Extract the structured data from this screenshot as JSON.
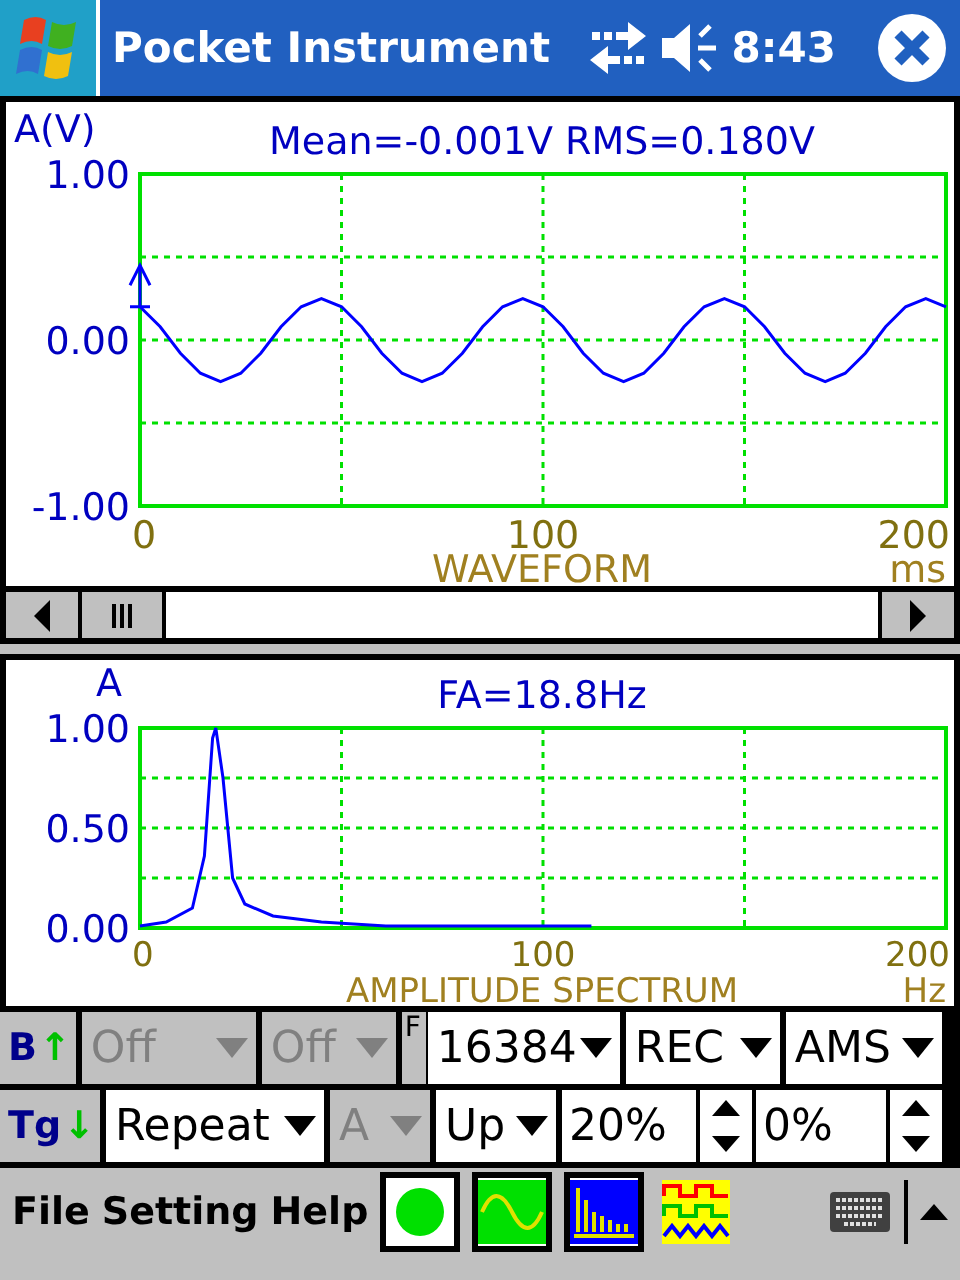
{
  "title_bar": {
    "title": "Pocket Instrument",
    "time": "8:43"
  },
  "waveform": {
    "y_unit": "A(V)",
    "title": "Mean=-0.001V RMS=0.180V",
    "x_unit": "ms",
    "chart_data": {
      "type": "line",
      "xlabel": "WAVEFORM",
      "x": [
        0,
        5,
        10,
        15,
        20,
        25,
        30,
        35,
        40,
        45,
        50,
        55,
        60,
        65,
        70,
        75,
        80,
        85,
        90,
        95,
        100,
        105,
        110,
        115,
        120,
        125,
        130,
        135,
        140,
        145,
        150,
        155,
        160,
        165,
        170,
        175,
        180,
        185,
        190,
        195,
        200
      ],
      "series": [
        {
          "color": "#0000ff",
          "values": [
            0.2,
            0.08,
            -0.08,
            -0.2,
            -0.25,
            -0.2,
            -0.08,
            0.08,
            0.2,
            0.25,
            0.2,
            0.08,
            -0.08,
            -0.2,
            -0.25,
            -0.2,
            -0.08,
            0.08,
            0.2,
            0.25,
            0.2,
            0.08,
            -0.08,
            -0.2,
            -0.25,
            -0.2,
            -0.08,
            0.08,
            0.2,
            0.25,
            0.2,
            0.08,
            -0.08,
            -0.2,
            -0.25,
            -0.2,
            -0.08,
            0.08,
            0.2,
            0.25,
            0.2
          ]
        }
      ],
      "xlim": [
        0,
        200
      ],
      "ylim": [
        -1,
        1
      ],
      "xticks": [
        0,
        100,
        200
      ],
      "yticks": [
        {
          "value": -1,
          "label": "-1.00"
        },
        {
          "value": 0,
          "label": "0.00"
        },
        {
          "value": 1,
          "label": "1.00"
        }
      ]
    }
  },
  "spectrum": {
    "y_unit": "A",
    "title": "FA=18.8Hz",
    "x_unit": "Hz",
    "chart_data": {
      "type": "line",
      "xlabel": "AMPLITUDE SPECTRUM",
      "x": [
        0,
        6.5,
        13,
        16,
        18,
        18.8,
        20.6,
        23,
        26,
        33,
        45,
        61,
        112
      ],
      "series": [
        {
          "color": "#0000ff",
          "values": [
            0.01,
            0.03,
            0.1,
            0.36,
            0.95,
            1.0,
            0.75,
            0.25,
            0.12,
            0.06,
            0.03,
            0.01,
            0.01
          ]
        }
      ],
      "xlim": [
        0,
        200
      ],
      "ylim": [
        0,
        1
      ],
      "xticks": [
        0,
        100,
        200
      ],
      "yticks": [
        {
          "value": 0,
          "label": "0.00"
        },
        {
          "value": 0.5,
          "label": "0.50"
        },
        {
          "value": 1,
          "label": "1.00"
        }
      ]
    }
  },
  "control_rows": [
    {
      "label": "B",
      "arrow": "↑",
      "items": [
        {
          "kind": "dropdown",
          "value": "Off",
          "disabled": true
        },
        {
          "kind": "dropdown",
          "value": "Off",
          "disabled": true
        },
        {
          "kind": "label",
          "value": "F"
        },
        {
          "kind": "dropdown",
          "value": "16384",
          "disabled": false
        },
        {
          "kind": "dropdown",
          "value": "REC",
          "disabled": false
        },
        {
          "kind": "dropdown",
          "value": "AMS",
          "disabled": false
        }
      ]
    },
    {
      "label": "Tg",
      "arrow": "↓",
      "items": [
        {
          "kind": "dropdown",
          "value": "Repeat",
          "disabled": false
        },
        {
          "kind": "dropdown",
          "value": "A",
          "disabled": true
        },
        {
          "kind": "dropdown",
          "value": "Up",
          "disabled": false
        },
        {
          "kind": "spin",
          "value": "20%",
          "disabled": false
        },
        {
          "kind": "spin",
          "value": "0%",
          "disabled": false
        }
      ]
    }
  ],
  "menu": [
    "File",
    "Setting",
    "Help"
  ],
  "tools": [
    {
      "kind": "record",
      "selected": true
    },
    {
      "kind": "wave",
      "selected": true
    },
    {
      "kind": "spectrum",
      "selected": true
    },
    {
      "kind": "multi",
      "selected": false
    }
  ]
}
